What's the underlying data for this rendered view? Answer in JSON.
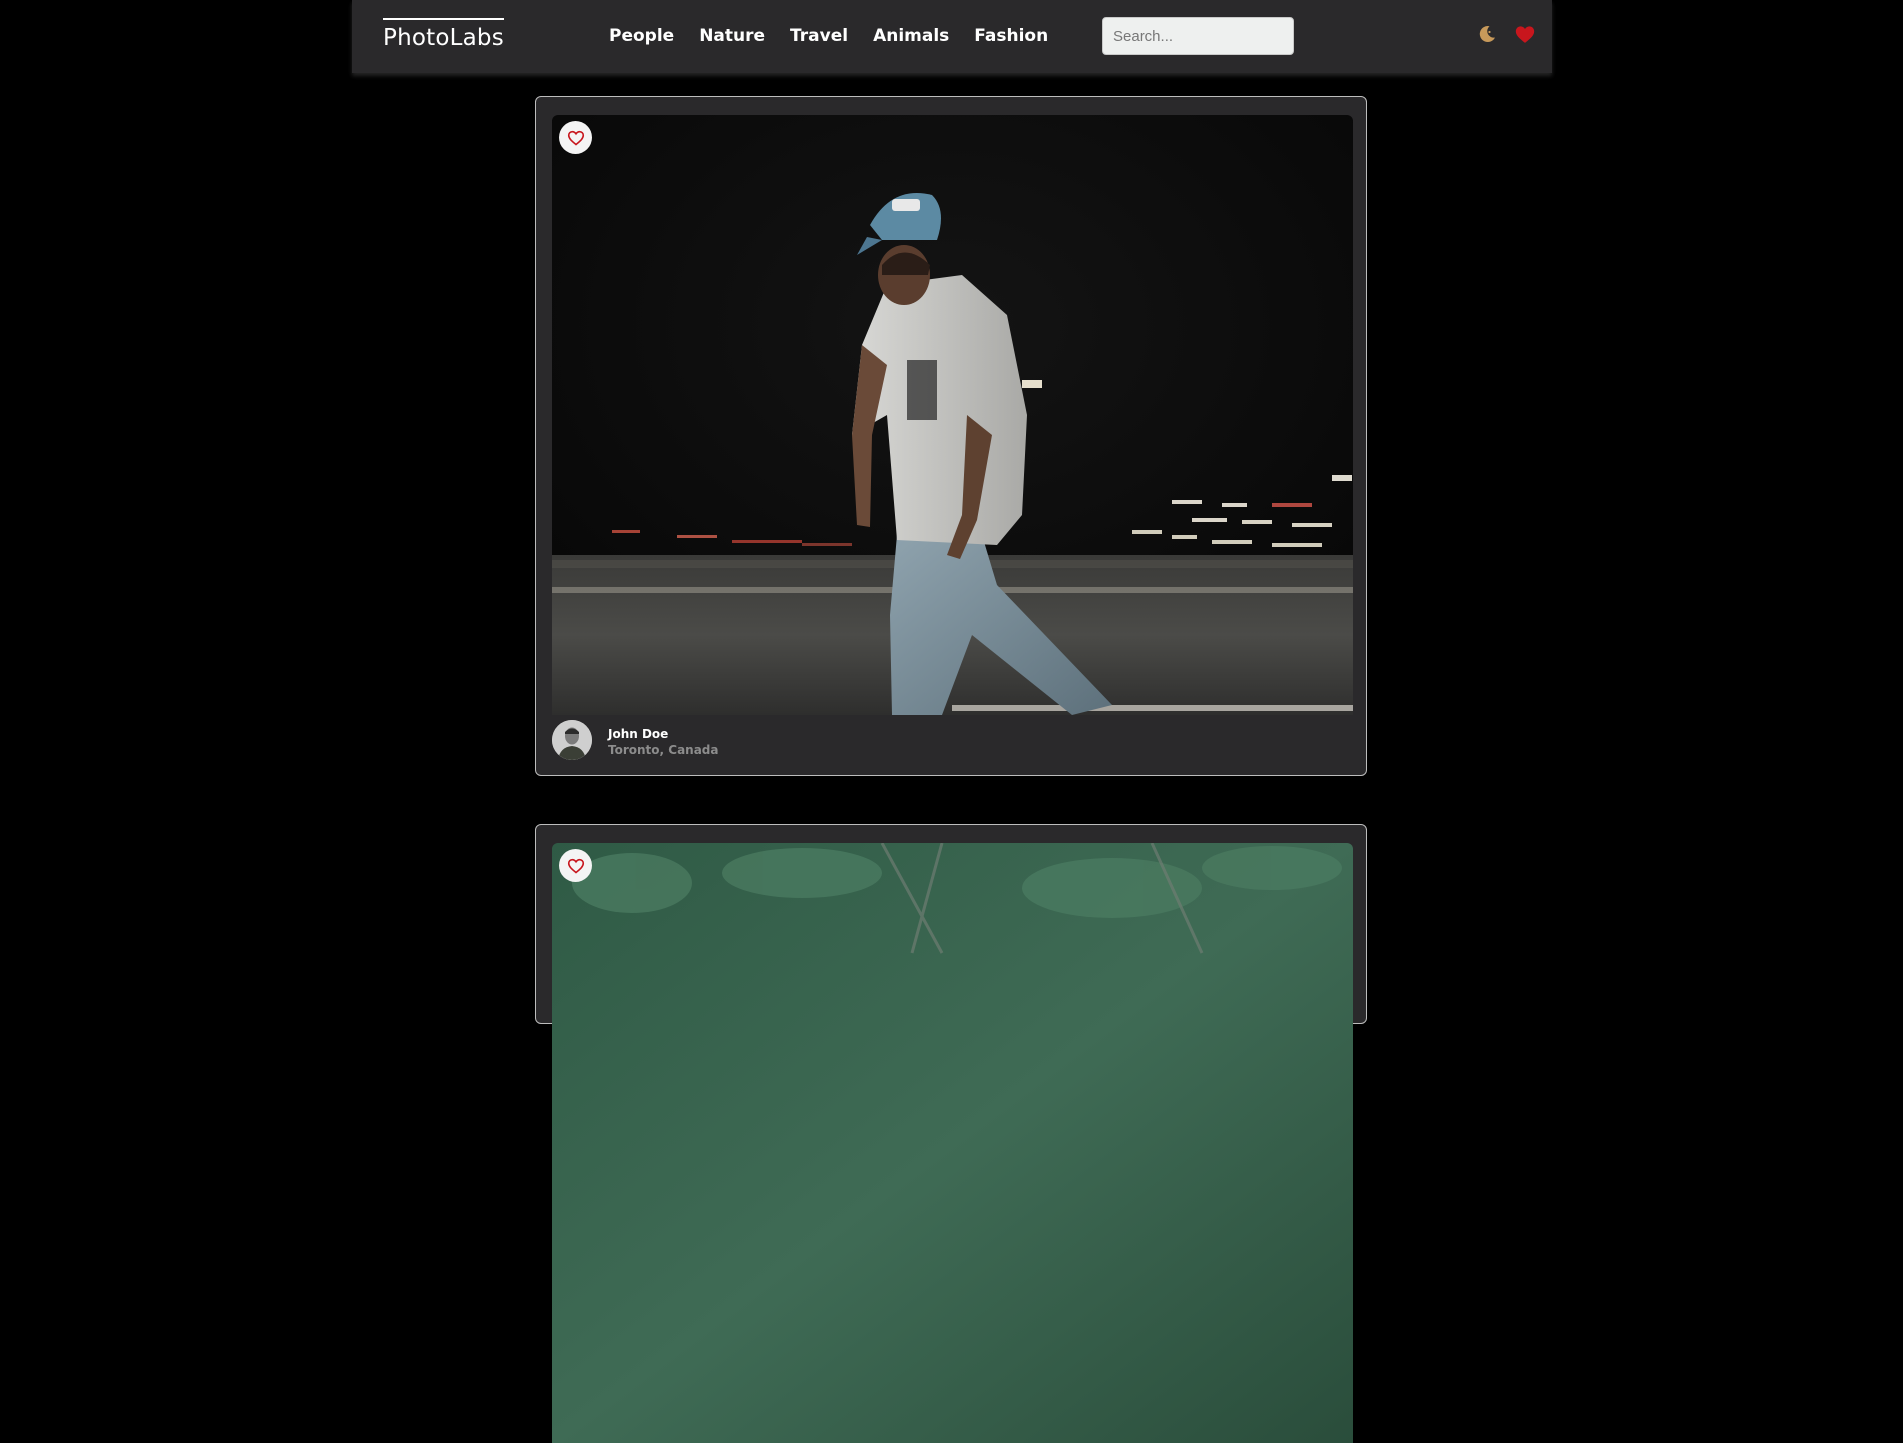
{
  "navbar": {
    "brand": "PhotoLabs",
    "topics": [
      "People",
      "Nature",
      "Travel",
      "Animals",
      "Fashion"
    ],
    "search_placeholder": "Search...",
    "theme_icon": "moon-icon",
    "favorites_icon": "heart-filled-icon"
  },
  "photos": [
    {
      "user": {
        "name": "John Doe",
        "location": "Toronto, Canada"
      },
      "favorite_icon": "heart-outline-icon",
      "image_icon": "photo-man-night-parking-lot"
    },
    {
      "favorite_icon": "heart-outline-icon",
      "image_icon": "photo-green-foliage"
    }
  ],
  "colors": {
    "background": "#000000",
    "navbar": "#2a292b",
    "card": "#2a292b",
    "heart": "#c8161d",
    "moon": "#c7995a"
  }
}
